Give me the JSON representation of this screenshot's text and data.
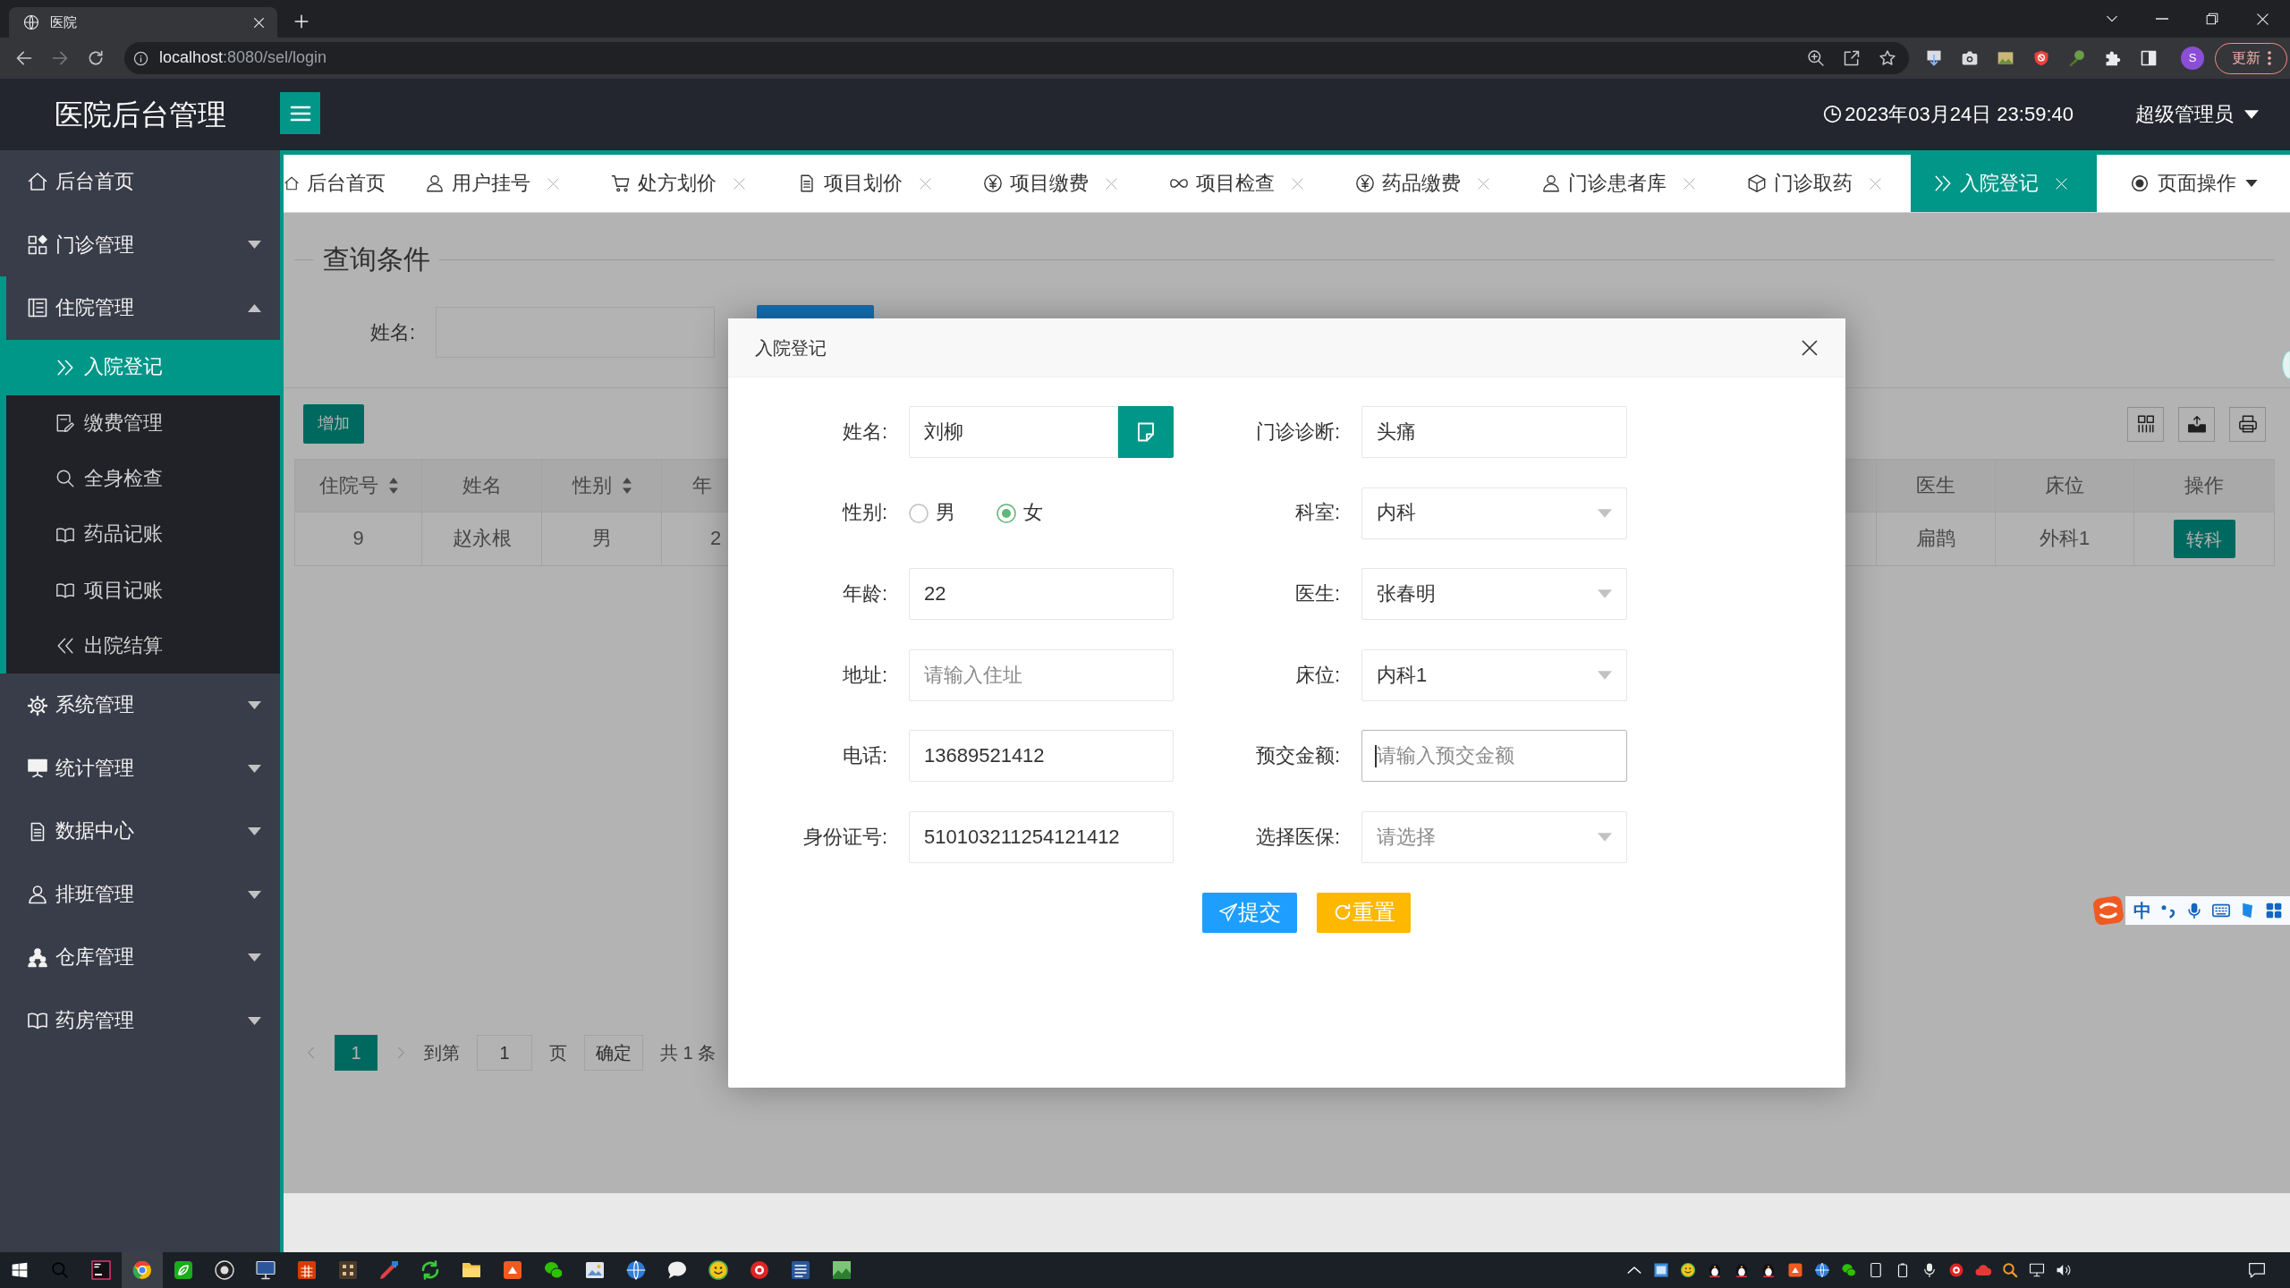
{
  "browser": {
    "tab_title": "医院",
    "address": {
      "host": "localhost",
      "path": ":8080/sel/login"
    },
    "profile_initial": "S",
    "update_button": "更新"
  },
  "header": {
    "title": "医院后台管理",
    "datetime": "2023年03月24日 23:59:40",
    "user": "超级管理员"
  },
  "sidebar": {
    "items": [
      {
        "label": "后台首页",
        "kind": "link",
        "selected": false
      },
      {
        "label": "门诊管理",
        "kind": "group",
        "selected": false,
        "expanded": false
      },
      {
        "label": "住院管理",
        "kind": "group",
        "selected": false,
        "expanded": true,
        "children": [
          {
            "label": "入院登记",
            "selected": true
          },
          {
            "label": "缴费管理",
            "selected": false
          },
          {
            "label": "全身检查",
            "selected": false
          },
          {
            "label": "药品记账",
            "selected": false
          },
          {
            "label": "项目记账",
            "selected": false
          },
          {
            "label": "出院结算",
            "selected": false
          }
        ]
      },
      {
        "label": "系统管理",
        "kind": "group",
        "selected": false,
        "expanded": false
      },
      {
        "label": "统计管理",
        "kind": "group",
        "selected": false,
        "expanded": false
      },
      {
        "label": "数据中心",
        "kind": "group",
        "selected": false,
        "expanded": false
      },
      {
        "label": "排班管理",
        "kind": "group",
        "selected": false,
        "expanded": false
      },
      {
        "label": "仓库管理",
        "kind": "group",
        "selected": false,
        "expanded": false
      },
      {
        "label": "药房管理",
        "kind": "group",
        "selected": false,
        "expanded": false
      }
    ]
  },
  "tabs": [
    {
      "label": "后台首页",
      "closable": false,
      "selected": false
    },
    {
      "label": "用户挂号",
      "closable": true,
      "selected": false
    },
    {
      "label": "处方划价",
      "closable": true,
      "selected": false
    },
    {
      "label": "项目划价",
      "closable": true,
      "selected": false
    },
    {
      "label": "项目缴费",
      "closable": true,
      "selected": false
    },
    {
      "label": "项目检查",
      "closable": true,
      "selected": false
    },
    {
      "label": "药品缴费",
      "closable": true,
      "selected": false
    },
    {
      "label": "门诊患者库",
      "closable": true,
      "selected": false
    },
    {
      "label": "门诊取药",
      "closable": true,
      "selected": false
    },
    {
      "label": "入院登记",
      "closable": true,
      "selected": true
    }
  ],
  "page_actions": {
    "label": "页面操作"
  },
  "query": {
    "legend": "查询条件",
    "fields": [
      {
        "label": "姓名:"
      }
    ]
  },
  "toolbar": {
    "add_button": "增加"
  },
  "table": {
    "left_columns": [
      {
        "label": "住院号",
        "sortable": true
      },
      {
        "label": "姓名",
        "sortable": false
      },
      {
        "label": "性别",
        "sortable": true
      },
      {
        "label": "年",
        "sortable": false
      }
    ],
    "right_columns": [
      {
        "label": "医生",
        "sortable": false
      },
      {
        "label": "床位",
        "sortable": false
      },
      {
        "label": "操作",
        "sortable": false
      }
    ],
    "rows": [
      {
        "left_cells": [
          "9",
          "赵永根",
          "男",
          "2"
        ],
        "right_cells": [
          "扁鹊",
          "外科1"
        ],
        "action": "转科"
      }
    ]
  },
  "pagination": {
    "prev_disabled": true,
    "pages": [
      {
        "label": "1",
        "selected": true
      }
    ],
    "next_disabled": true,
    "goto_label": "到第",
    "goto_value": "1",
    "page_unit": "页",
    "confirm_button": "确定",
    "total": "共 1 条"
  },
  "dialog": {
    "title": "入院登记",
    "fields": [
      {
        "kind": "lookup",
        "label": "姓名:",
        "value": "刘柳",
        "focused": false
      },
      {
        "kind": "text",
        "label": "门诊诊断:",
        "value": "头痛",
        "focused": false
      },
      {
        "kind": "radio",
        "label": "性别:",
        "options": [
          {
            "label": "男",
            "selected": false
          },
          {
            "label": "女",
            "selected": true
          }
        ]
      },
      {
        "kind": "select",
        "label": "科室:",
        "value": "内科",
        "focused": false
      },
      {
        "kind": "text",
        "label": "年龄:",
        "value": "22",
        "focused": false
      },
      {
        "kind": "select",
        "label": "医生:",
        "value": "张春明",
        "focused": false
      },
      {
        "kind": "text",
        "label": "地址:",
        "placeholder": "请输入住址",
        "focused": false
      },
      {
        "kind": "select",
        "label": "床位:",
        "value": "内科1",
        "focused": false
      },
      {
        "kind": "text",
        "label": "电话:",
        "value": "13689521412",
        "focused": false
      },
      {
        "kind": "text",
        "label": "预交金额:",
        "placeholder": "请输入预交金额",
        "focused": true
      },
      {
        "kind": "text",
        "label": "身份证号:",
        "value": "510103211254121412",
        "focused": false
      },
      {
        "kind": "select",
        "label": "选择医保:",
        "placeholder": "请选择",
        "focused": false
      }
    ],
    "buttons": [
      {
        "label": "提交",
        "kind": "submit"
      },
      {
        "label": "重置",
        "kind": "reset"
      }
    ]
  },
  "ime_toolbar": {
    "mode": "中"
  },
  "taskbar": {
    "apps": [
      {
        "active": false
      },
      {
        "active": true
      },
      {
        "active": false
      },
      {
        "active": false
      },
      {
        "active": false
      },
      {
        "active": false
      },
      {
        "active": false
      },
      {
        "active": false
      },
      {
        "active": false
      },
      {
        "active": false
      },
      {
        "active": false
      },
      {
        "active": false
      },
      {
        "active": false
      },
      {
        "active": false
      },
      {
        "active": false
      },
      {
        "active": false
      },
      {
        "active": false
      },
      {
        "active": false
      },
      {
        "active": false
      }
    ]
  }
}
